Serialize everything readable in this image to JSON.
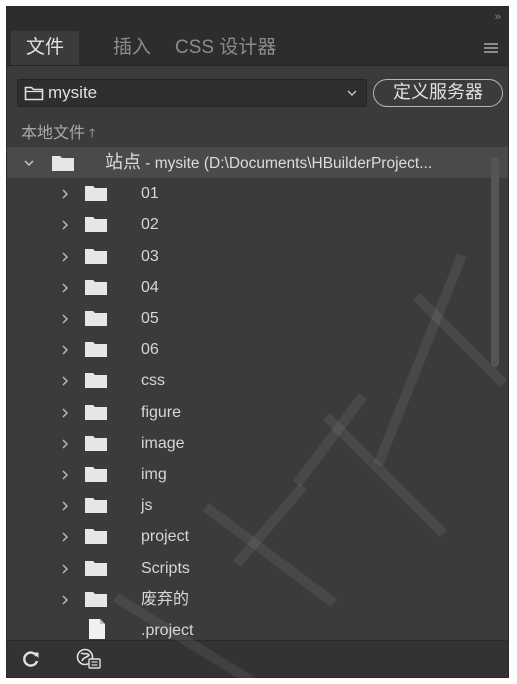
{
  "panel": {
    "collapse_glyph": "››",
    "tabs": [
      {
        "label": "文件",
        "active": true
      },
      {
        "label": "插入",
        "active": false
      },
      {
        "label": "CSS 设计器",
        "active": false
      }
    ],
    "menu_icon": "hamburger-icon"
  },
  "site_selector": {
    "value": "mysite",
    "icon": "folder-outline-icon"
  },
  "define_server_label": "定义服务器",
  "local_files": {
    "label": "本地文件",
    "sort_icon": "arrow-up-icon"
  },
  "tree": {
    "root": {
      "prefix": "站点",
      "rest": " - mysite (D:\\Documents\\HBuilderProject..."
    },
    "items": [
      {
        "name": "01",
        "type": "folder"
      },
      {
        "name": "02",
        "type": "folder"
      },
      {
        "name": "03",
        "type": "folder"
      },
      {
        "name": "04",
        "type": "folder"
      },
      {
        "name": "05",
        "type": "folder"
      },
      {
        "name": "06",
        "type": "folder"
      },
      {
        "name": "css",
        "type": "folder"
      },
      {
        "name": "figure",
        "type": "folder"
      },
      {
        "name": "image",
        "type": "folder"
      },
      {
        "name": "img",
        "type": "folder"
      },
      {
        "name": "js",
        "type": "folder"
      },
      {
        "name": "project",
        "type": "folder"
      },
      {
        "name": "Scripts",
        "type": "folder"
      },
      {
        "name": "废弃的",
        "type": "folder"
      },
      {
        "name": ".project",
        "type": "file"
      }
    ]
  },
  "colors": {
    "panel_bg": "#3b3b3b",
    "tab_bg": "#2d2d2d",
    "selected_row": "#4a4a4a",
    "text": "#d6d6d6"
  },
  "bottom_bar": {
    "refresh_icon": "refresh-icon",
    "connect_icon": "globe-connect-icon"
  }
}
